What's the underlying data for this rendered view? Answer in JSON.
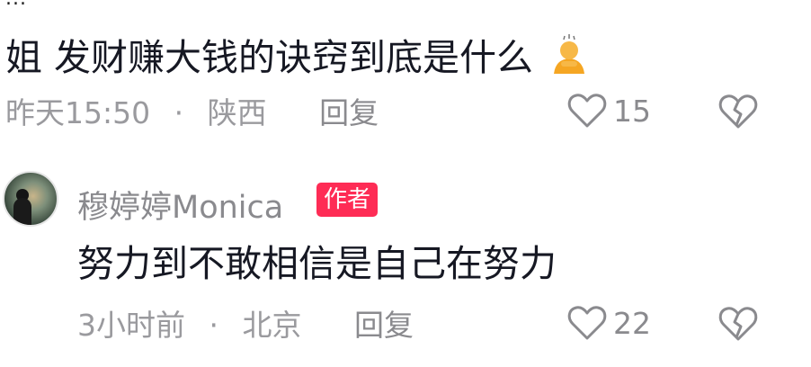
{
  "partial_top_text": "...",
  "comments": [
    {
      "text": "姐 发财赚大钱的诀窍到底是什么",
      "emoji": "person-bowing-emoji",
      "time": "昨天15:50",
      "separator": "·",
      "location": "陕西",
      "reply_label": "回复",
      "likes": "15"
    },
    {
      "username": "穆婷婷Monica",
      "badge": "作者",
      "text": "努力到不敢相信是自己在努力",
      "time": "3小时前",
      "separator": "·",
      "location": "北京",
      "reply_label": "回复",
      "likes": "22"
    }
  ],
  "colors": {
    "text_primary": "#161823",
    "text_secondary": "#8a8a8e",
    "badge_bg": "#fe2c55"
  }
}
